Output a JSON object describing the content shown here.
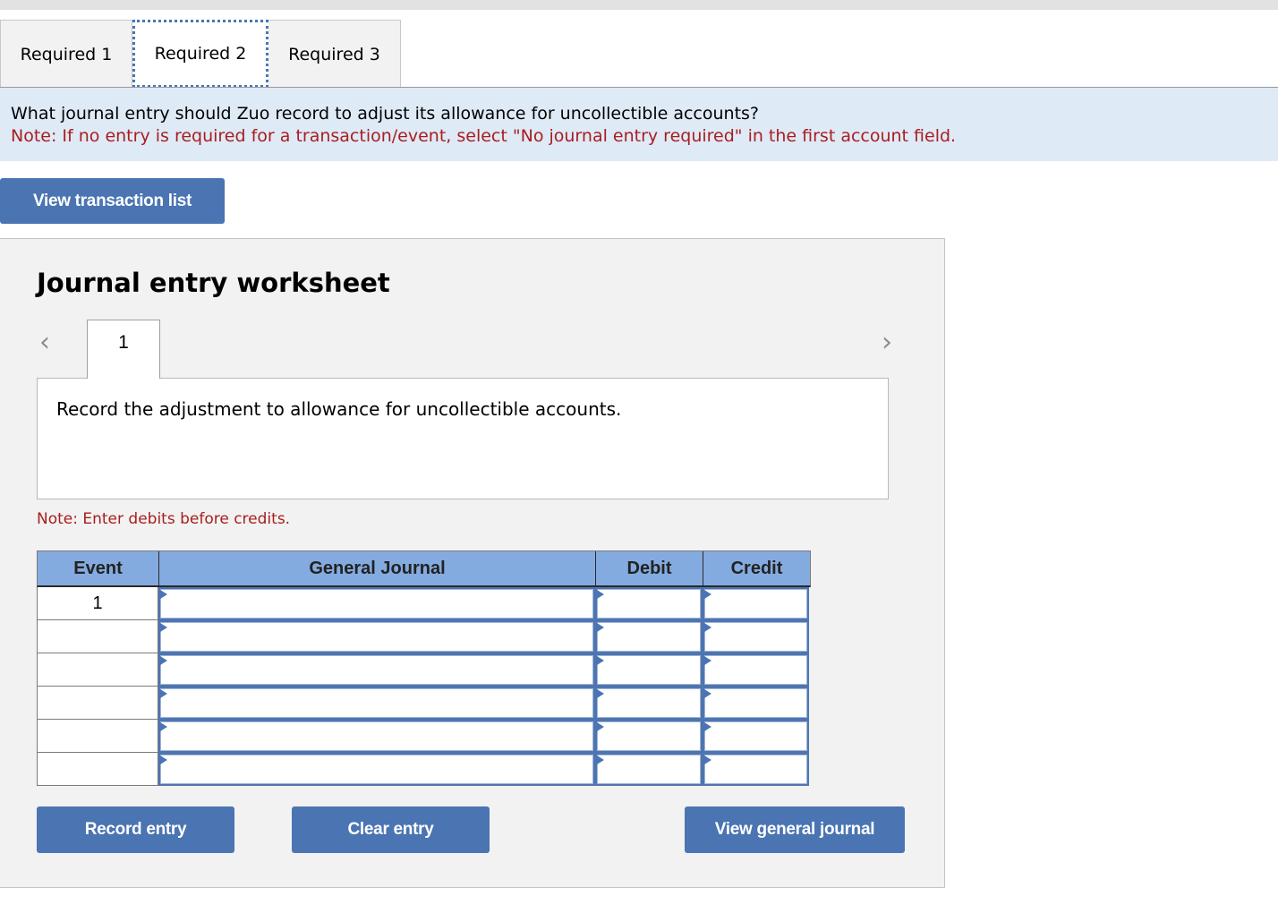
{
  "tabs": [
    {
      "label": "Required 1",
      "active": false
    },
    {
      "label": "Required 2",
      "active": true
    },
    {
      "label": "Required 3",
      "active": false
    }
  ],
  "question": {
    "text": "What journal entry should Zuo record to adjust its allowance for uncollectible accounts?",
    "note": "Note: If no entry is required for a transaction/event, select \"No journal entry required\" in the first account field."
  },
  "buttons": {
    "view_transaction_list": "View transaction list",
    "record_entry": "Record entry",
    "clear_entry": "Clear entry",
    "view_general_journal": "View general journal"
  },
  "worksheet": {
    "title": "Journal entry worksheet",
    "prev_icon": "chevron-left",
    "next_icon": "chevron-right",
    "prev_glyph": "‹",
    "next_glyph": "›",
    "current_entry_tab": "1",
    "prompt": "Record the adjustment to allowance for uncollectible accounts.",
    "note": "Note: Enter debits before credits."
  },
  "journal": {
    "headers": {
      "event": "Event",
      "account": "General Journal",
      "debit": "Debit",
      "credit": "Credit"
    },
    "rows": [
      {
        "event": "1",
        "account": "",
        "debit": "",
        "credit": ""
      },
      {
        "event": "",
        "account": "",
        "debit": "",
        "credit": ""
      },
      {
        "event": "",
        "account": "",
        "debit": "",
        "credit": ""
      },
      {
        "event": "",
        "account": "",
        "debit": "",
        "credit": ""
      },
      {
        "event": "",
        "account": "",
        "debit": "",
        "credit": ""
      },
      {
        "event": "",
        "account": "",
        "debit": "",
        "credit": ""
      }
    ]
  },
  "colors": {
    "accent_button": "#4a74b2",
    "header_blue": "#84abdf",
    "note_red": "#a81e1e",
    "question_bg": "#dfeaf7"
  }
}
